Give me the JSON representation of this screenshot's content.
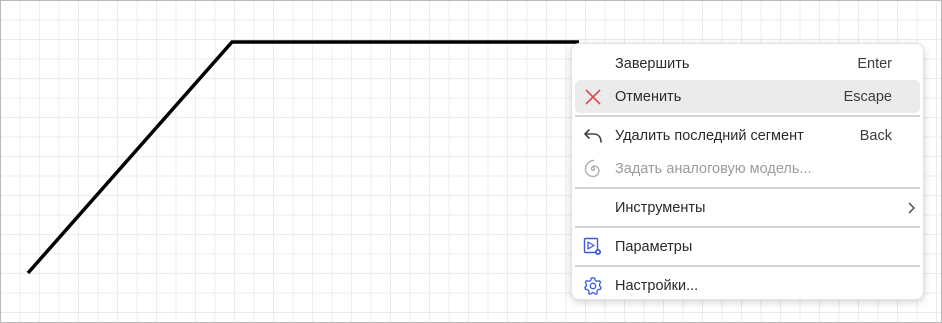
{
  "canvas": {
    "line_color": "#000000",
    "grid_color": "#ececec"
  },
  "context_menu": {
    "items": [
      {
        "label": "Завершить",
        "shortcut": "Enter",
        "icon": "none"
      },
      {
        "label": "Отменить",
        "shortcut": "Escape",
        "icon": "close-icon",
        "icon_color": "#d94c4c",
        "highlighted": true
      },
      {
        "label": "Удалить последний сегмент",
        "shortcut": "Back",
        "icon": "undo-icon"
      },
      {
        "label": "Задать аналоговую модель...",
        "shortcut": "",
        "icon": "spiral-icon",
        "disabled": true
      },
      {
        "label": "Инструменты",
        "shortcut": "",
        "icon": "none",
        "submenu": true
      },
      {
        "label": "Параметры",
        "shortcut": "",
        "icon": "parameters-icon",
        "icon_color": "#3b5bdb"
      },
      {
        "label": "Настройки...",
        "shortcut": "",
        "icon": "gear-icon",
        "icon_color": "#3b5bdb"
      }
    ]
  }
}
